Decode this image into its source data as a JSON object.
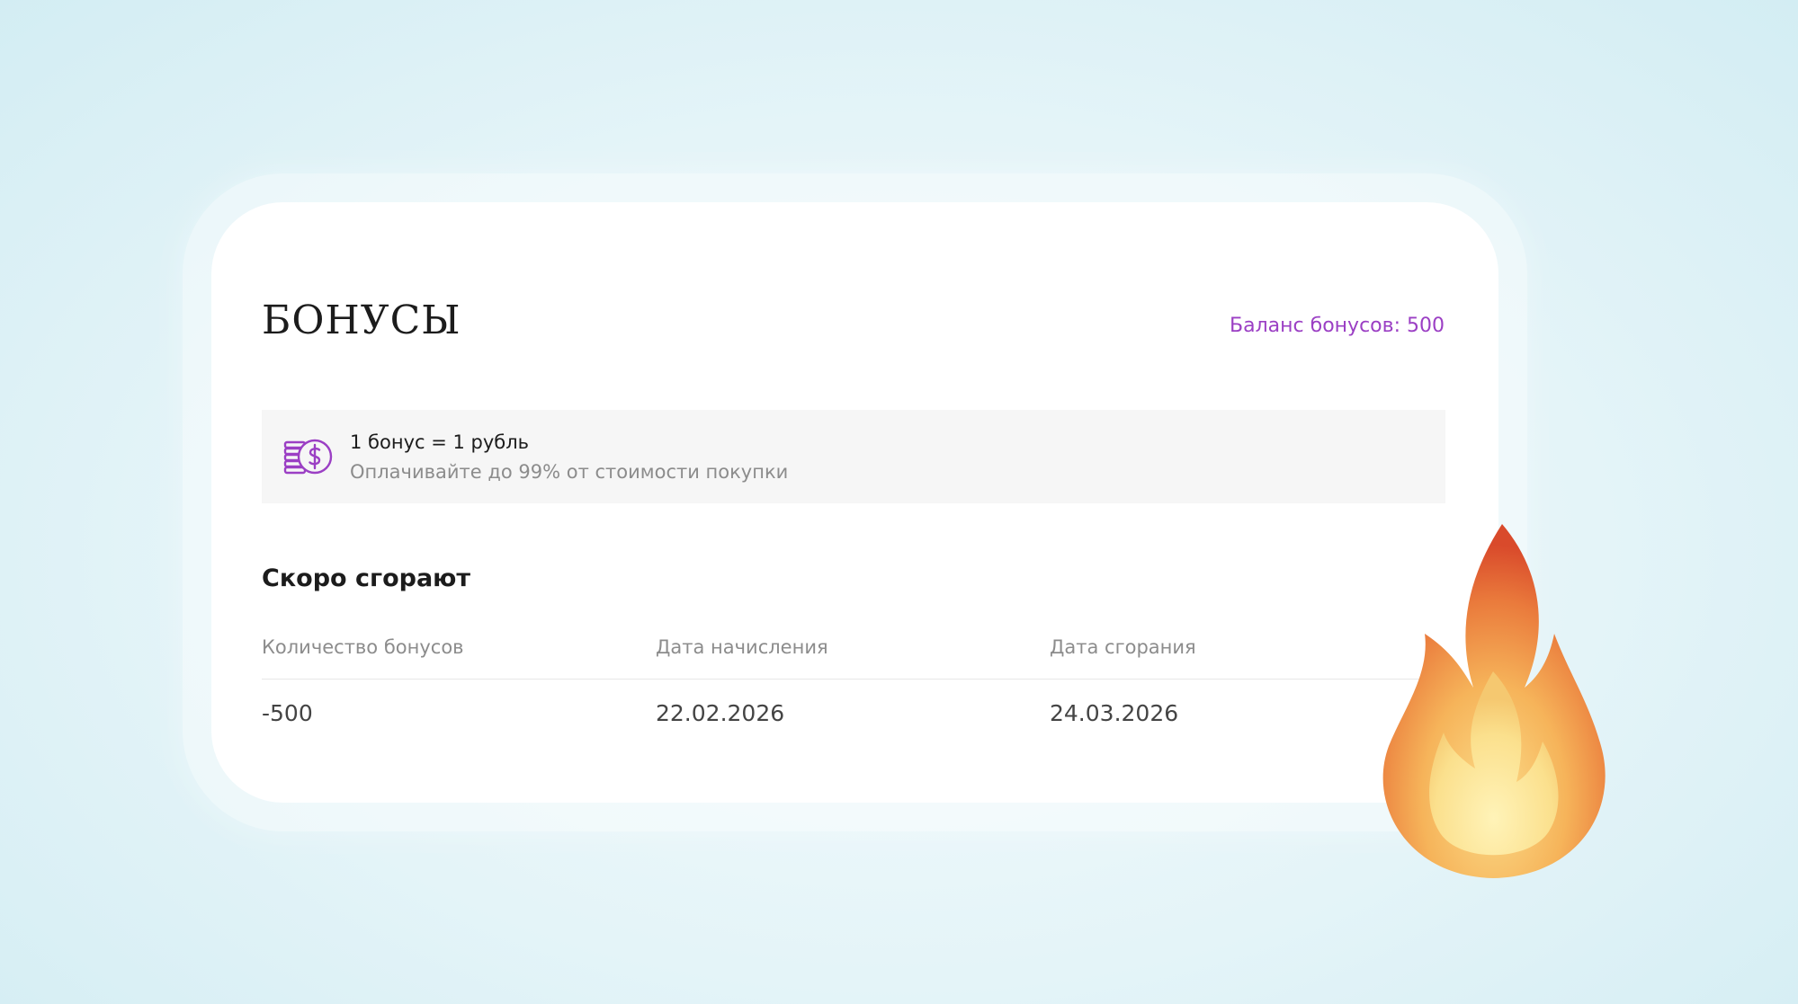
{
  "page": {
    "title": "БОНУСЫ",
    "balance_label": "Баланс бонусов: 500"
  },
  "rate": {
    "main": "1 бонус = 1 рубль",
    "sub": "Оплачивайте до 99% от стоимости покупки",
    "icon": "coins-dollar-icon"
  },
  "expiring": {
    "title": "Скоро сгорают",
    "columns": [
      "Количество бонусов",
      "Дата начисления",
      "Дата сгорания"
    ],
    "rows": [
      {
        "amount": "-500",
        "accrual_date": "22.02.2026",
        "expiry_date": "24.03.2026"
      }
    ]
  },
  "decor": {
    "icon": "fire-icon"
  },
  "colors": {
    "accent": "#9b3fc4",
    "panel_bg": "#f6f6f6",
    "text_primary": "#1c1c1c",
    "text_muted": "#8c8c8c"
  }
}
